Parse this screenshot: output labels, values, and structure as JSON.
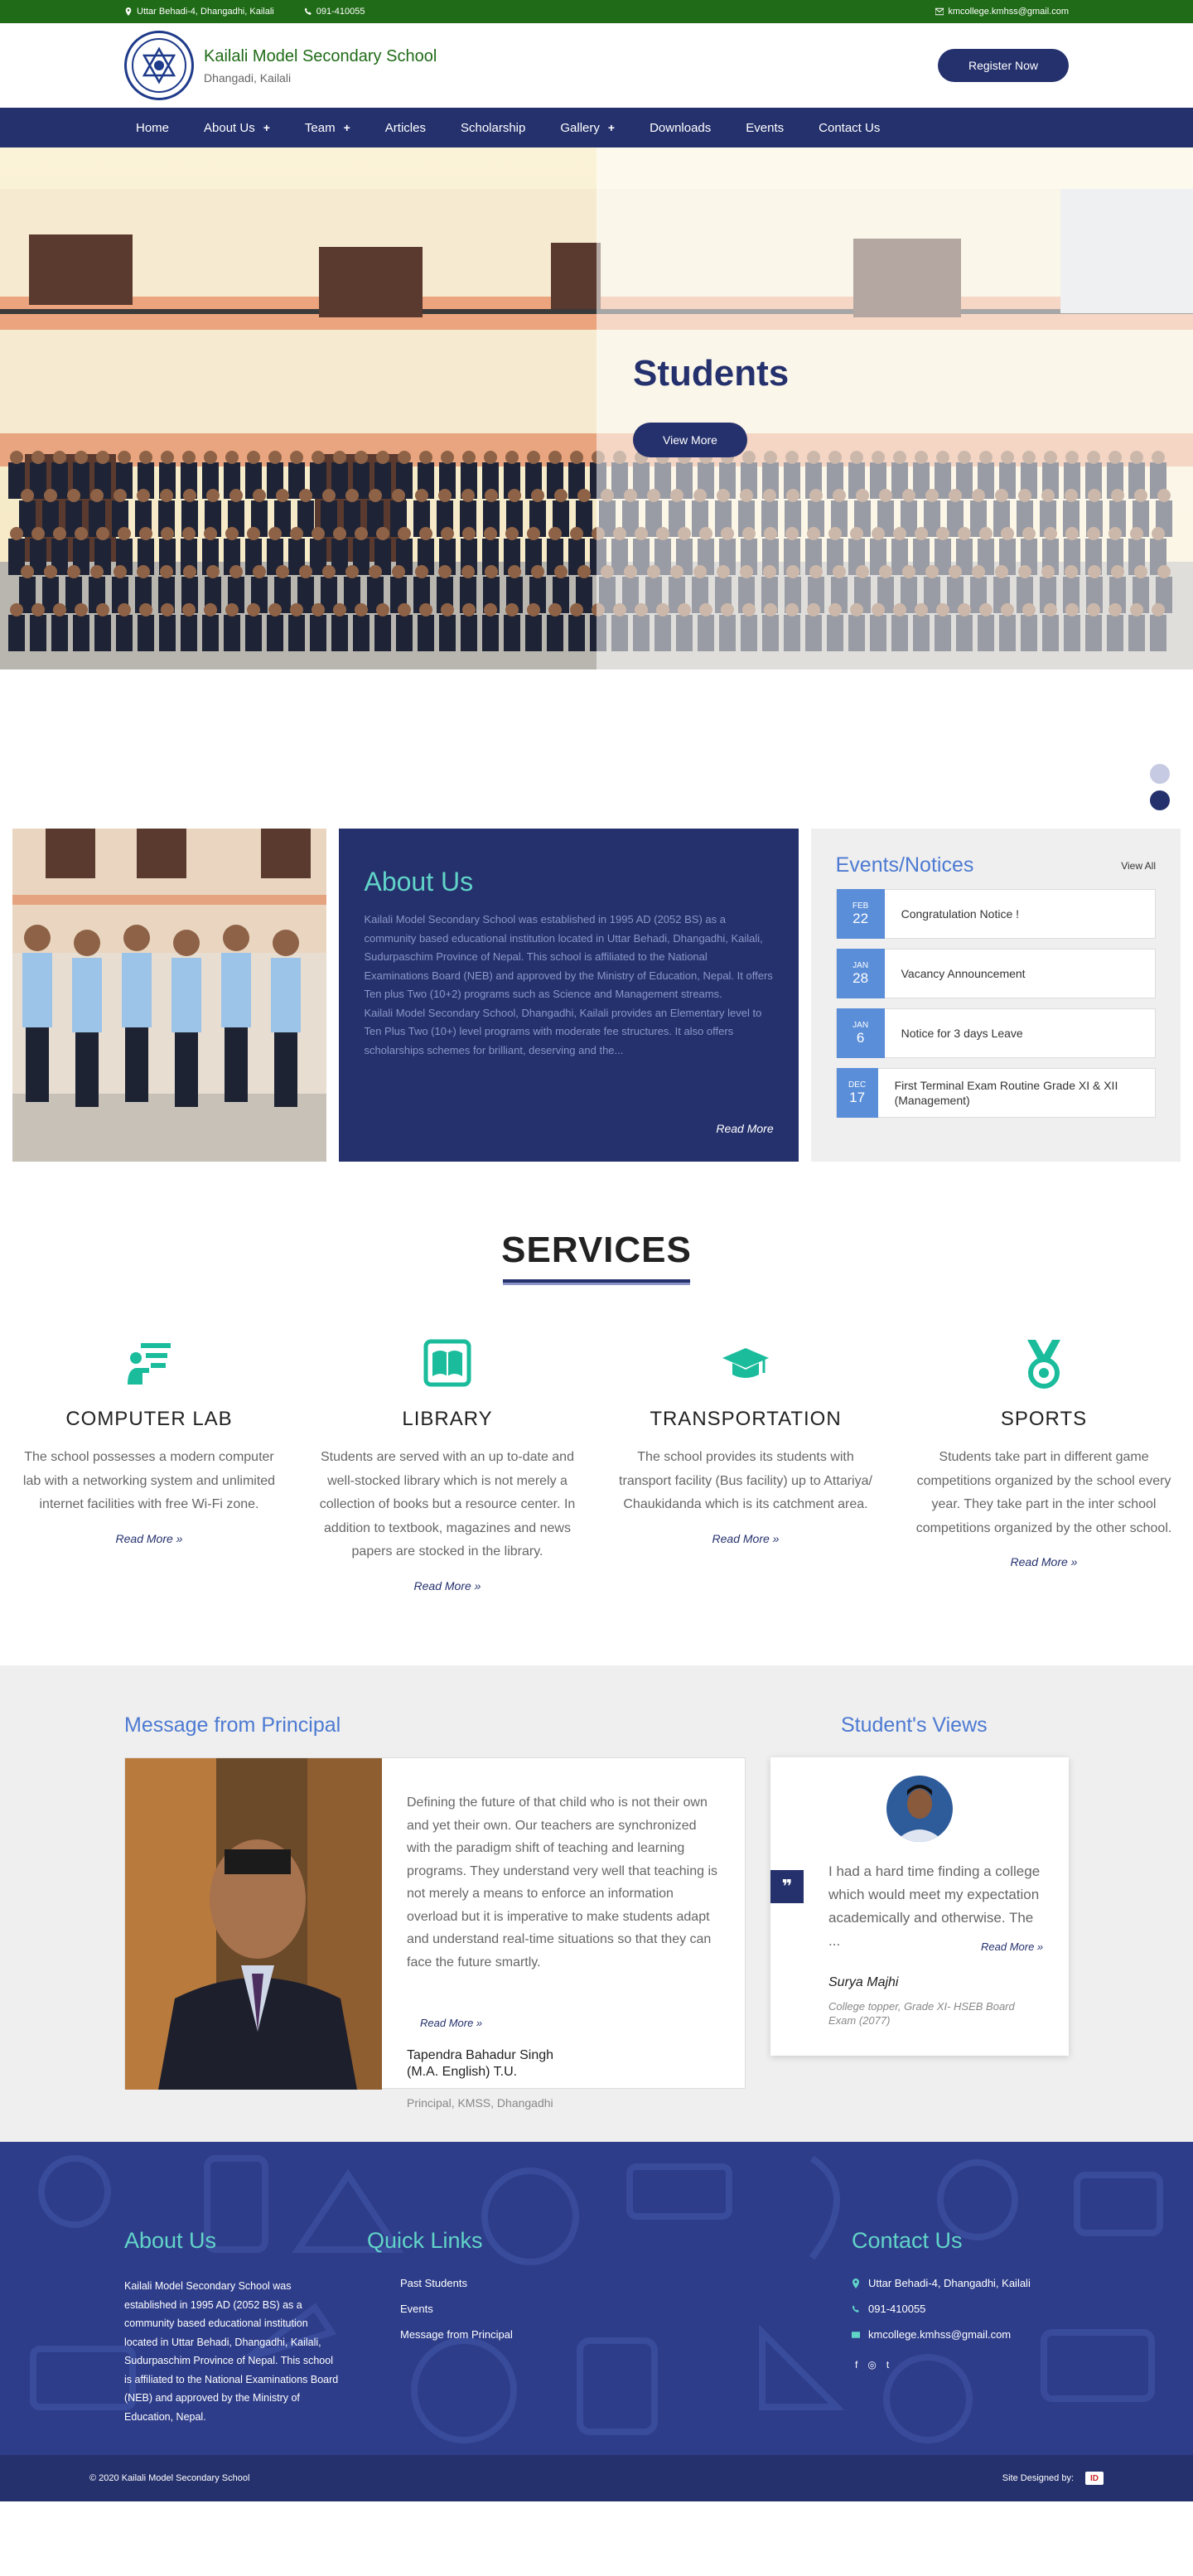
{
  "topbar": {
    "address": "Uttar Behadi-4, Dhangadhi, Kailali",
    "phone": "091-410055",
    "email": "kmcollege.kmhss@gmail.com"
  },
  "header": {
    "school_name": "Kailali Model Secondary School",
    "location": "Dhangadi, Kailali",
    "register_label": "Register Now"
  },
  "nav": {
    "items": [
      {
        "label": "Home",
        "dropdown": false
      },
      {
        "label": "About Us",
        "dropdown": true
      },
      {
        "label": "Team",
        "dropdown": true
      },
      {
        "label": "Articles",
        "dropdown": false
      },
      {
        "label": "Scholarship",
        "dropdown": false
      },
      {
        "label": "Gallery",
        "dropdown": true
      },
      {
        "label": "Downloads",
        "dropdown": false
      },
      {
        "label": "Events",
        "dropdown": false
      },
      {
        "label": "Contact Us",
        "dropdown": false
      }
    ],
    "plus": "+"
  },
  "hero": {
    "title": "Students",
    "button": "View More"
  },
  "about": {
    "title": "About Us",
    "p1": "Kailali Model Secondary School was established in 1995 AD (2052 BS) as a community based educational institution located in Uttar Behadi, Dhangadhi, Kailali, Sudurpaschim Province of Nepal. This school is affiliated to the National Examinations Board (NEB) and approved by the Ministry of Education, Nepal. It offers Ten plus Two (10+2) programs such as Science and Management streams.",
    "p2": "Kailali Model Secondary School, Dhangadhi, Kailali provides an Elementary level to Ten Plus Two (10+) level programs with moderate fee structures. It also offers scholarships schemes for brilliant, deserving and the...",
    "read_more": "Read More"
  },
  "events": {
    "title": "Events/Notices",
    "view_all": "View All",
    "items": [
      {
        "month": "FEB",
        "day": "22",
        "text": "Congratulation Notice !"
      },
      {
        "month": "JAN",
        "day": "28",
        "text": "Vacancy Announcement"
      },
      {
        "month": "JAN",
        "day": "6",
        "text": "Notice for 3 days Leave"
      },
      {
        "month": "DEC",
        "day": "17",
        "text": "First Terminal Exam Routine Grade XI & XII (Management)"
      }
    ]
  },
  "services": {
    "title": "SERVICES",
    "items": [
      {
        "icon": "computer-lab-icon",
        "title": "COMPUTER LAB",
        "text": "The school possesses a modern computer lab with a networking system and unlimited internet facilities with free Wi-Fi zone.",
        "read_more": "Read More »"
      },
      {
        "icon": "library-icon",
        "title": "LIBRARY",
        "text": "Students are served with an up to-date and well-stocked library which is not merely a collection of books but a resource center. In addition to textbook, magazines and news papers are stocked in the library.",
        "read_more": "Read More »"
      },
      {
        "icon": "transportation-icon",
        "title": "TRANSPORTATION",
        "text": "The school provides its students with transport facility (Bus facility) up to Attariya/ Chaukidanda which is its catchment area.",
        "read_more": "Read More »"
      },
      {
        "icon": "sports-icon",
        "title": "SPORTS",
        "text": "Students take part in different game competitions organized by the school every year. They take part in the inter school competitions organized by the other school.",
        "read_more": "Read More »"
      }
    ],
    "accent": "#1abc9c"
  },
  "principal": {
    "heading": "Message from Principal",
    "text": "Defining the future of that child who is not their own and yet their own. Our teachers are synchronized with the paradigm shift of teaching and learning programs. They understand very well that teaching is not merely a means to enforce an information overload but it is imperative to make students adapt and understand real-time situations so that they can face the future smartly.",
    "read_more": "Read More »",
    "name_line1": "Tapendra Bahadur Singh",
    "name_line2": "(M.A. English) T.U.",
    "role": "Principal, KMSS, Dhangadhi"
  },
  "views": {
    "heading": "Student's Views",
    "quote_mark": "❞",
    "text": "I had a hard time finding a college which would meet my expectation academically and otherwise. The ...",
    "read_more": "Read More »",
    "name": "Surya Majhi",
    "role": "College topper, Grade XI- HSEB Board Exam (2077)"
  },
  "footer": {
    "about_title": "About Us",
    "about_text": "Kailali Model Secondary School was established in 1995 AD (2052 BS) as a community based educational institution located in Uttar Behadi, Dhangadhi, Kailali, Sudurpaschim Province of Nepal. This school is affiliated to the National Examinations Board (NEB) and approved by the Ministry of Education, Nepal.",
    "quick_title": "Quick Links",
    "quick_links": [
      "Past Students",
      "Events",
      "Message from Principal"
    ],
    "contact_title": "Contact Us",
    "address": "Uttar Behadi-4, Dhangadhi, Kailali",
    "phone": "091-410055",
    "email": "kmcollege.kmhss@gmail.com",
    "social": [
      "f",
      "◎",
      "t"
    ],
    "copyright": "© 2020 Kailali Model Secondary School",
    "designed_by": "Site Designed by:",
    "designer_logo": "ID"
  },
  "colors": {
    "navy": "#25316d",
    "green": "#1f6b17",
    "teal": "#61d4c8",
    "blue_heading": "#4d7ad2"
  }
}
